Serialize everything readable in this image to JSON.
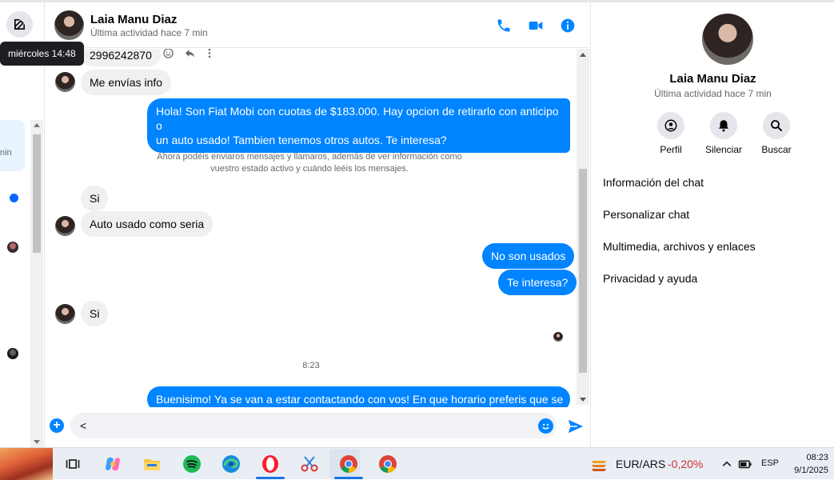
{
  "tooltip": "miércoles 14:48",
  "left_preview_suffix": "nin",
  "contact": {
    "name": "Laia Manu Diaz",
    "status": "Última actividad hace 7 min"
  },
  "messages": {
    "phone_partial": "2996242870",
    "m1": "Me envías info",
    "m2_line1": "Hola! Son Fiat Mobi con cuotas de $183.000. Hay opcion de retirarlo con anticipo o",
    "m2_line2": "un auto usado! Tambien tenemos otros autos. Te interesa?",
    "system_line1": "Ahora podéis enviaros mensajes y llamaros, además de ver información como",
    "system_line2": "vuestro estado activo y cuándo leéis los mensajes.",
    "m3": "Si",
    "m4": "Auto usado como seria",
    "m5": "No son usados",
    "m6": "Te interesa?",
    "m7": "Si",
    "time_divider": "8:23",
    "m8": "Buenisimo! Ya se van a estar contactando con vos! En que horario preferis que se"
  },
  "composer": {
    "value": "<"
  },
  "right_panel": {
    "actions": [
      "Perfil",
      "Silenciar",
      "Buscar"
    ],
    "menu": [
      "Información del chat",
      "Personalizar chat",
      "Multimedia, archivos y enlaces",
      "Privacidad y ayuda"
    ]
  },
  "taskbar": {
    "currency": "EUR/ARS",
    "change": "-0,20%",
    "language": "ESP",
    "time": "08:23",
    "date": "9/1/2025"
  },
  "colors": {
    "accent": "#0084ff",
    "negative": "#d32f2f"
  }
}
